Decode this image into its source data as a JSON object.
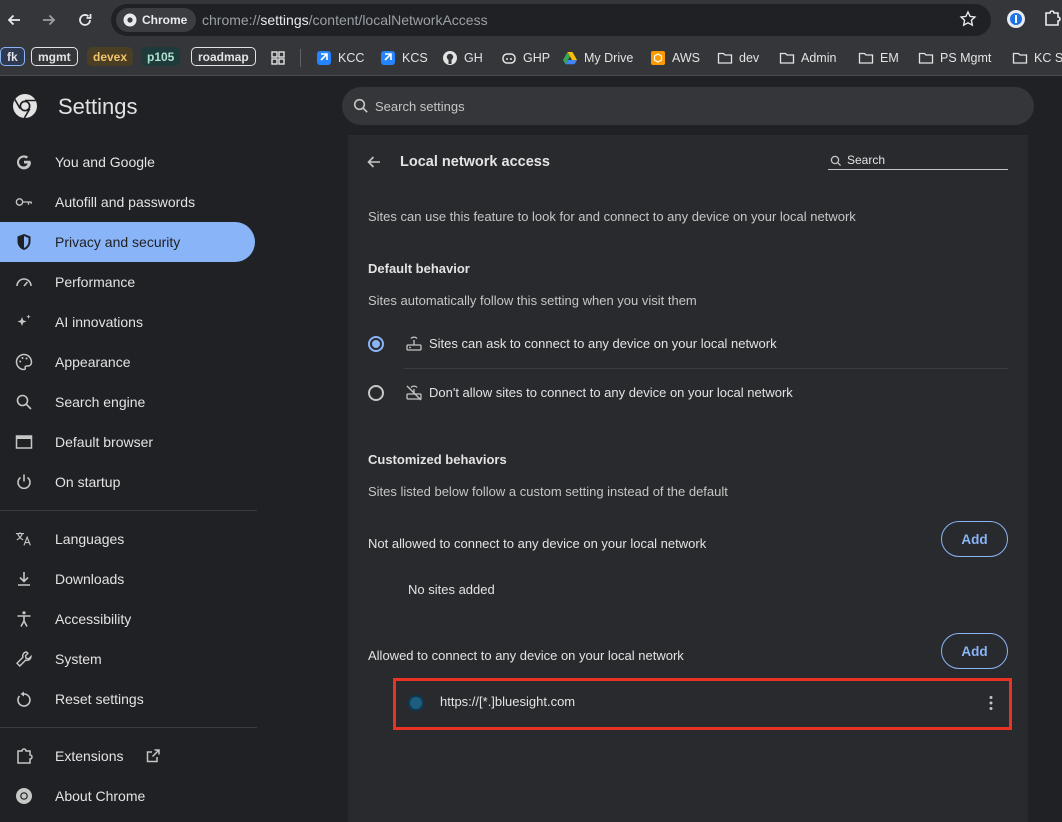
{
  "browser": {
    "chip_label": "Chrome",
    "url_prefix": "chrome://",
    "url_bold": "settings",
    "url_rest": "/content/localNetworkAccess",
    "bookmarks": {
      "tags": [
        {
          "label": "fk",
          "color": "#8ab4f8",
          "bg": "#3c4a66"
        },
        {
          "label": "mgmt",
          "color": "#e3e3e3",
          "bg": "#202124"
        },
        {
          "label": "devex",
          "color": "#f2c36b",
          "bg": "#4a3f24"
        },
        {
          "label": "p105",
          "color": "#81c995",
          "bg": "#1f3a2a"
        },
        {
          "label": "roadmap",
          "color": "#e3e3e3",
          "bg": "#202124"
        }
      ],
      "items": [
        "KCC",
        "KCS",
        "GH",
        "GHP",
        "My Drive",
        "AWS",
        "dev",
        "Admin",
        "EM",
        "PS Mgmt",
        "KC S"
      ]
    }
  },
  "settings": {
    "title": "Settings",
    "search_placeholder": "Search settings"
  },
  "sidebar": {
    "items": [
      {
        "label": "You and Google",
        "icon": "google-g-icon"
      },
      {
        "label": "Autofill and passwords",
        "icon": "key-icon"
      },
      {
        "label": "Privacy and security",
        "icon": "shield-icon",
        "active": true
      },
      {
        "label": "Performance",
        "icon": "gauge-icon"
      },
      {
        "label": "AI innovations",
        "icon": "sparkle-icon"
      },
      {
        "label": "Appearance",
        "icon": "palette-icon"
      },
      {
        "label": "Search engine",
        "icon": "search-icon"
      },
      {
        "label": "Default browser",
        "icon": "browser-window-icon"
      },
      {
        "label": "On startup",
        "icon": "power-icon"
      },
      {
        "label": "Languages",
        "icon": "translate-icon"
      },
      {
        "label": "Downloads",
        "icon": "download-icon"
      },
      {
        "label": "Accessibility",
        "icon": "accessibility-icon"
      },
      {
        "label": "System",
        "icon": "wrench-icon"
      },
      {
        "label": "Reset settings",
        "icon": "reset-icon"
      },
      {
        "label": "Extensions",
        "icon": "puzzle-icon"
      },
      {
        "label": "About Chrome",
        "icon": "chrome-logo-icon"
      }
    ]
  },
  "page": {
    "title": "Local network access",
    "search_placeholder": "Search",
    "description": "Sites can use this feature to look for and connect to any device on your local network",
    "default_behavior": {
      "heading": "Default behavior",
      "subtitle": "Sites automatically follow this setting when you visit them",
      "options": [
        {
          "label": "Sites can ask to connect to any device on your local network",
          "selected": true
        },
        {
          "label": "Don't allow sites to connect to any device on your local network",
          "selected": false
        }
      ]
    },
    "customized": {
      "heading": "Customized behaviors",
      "subtitle": "Sites listed below follow a custom setting instead of the default",
      "not_allowed": {
        "label": "Not allowed to connect to any device on your local network",
        "add_label": "Add",
        "empty_text": "No sites added"
      },
      "allowed": {
        "label": "Allowed to connect to any device on your local network",
        "add_label": "Add",
        "sites": [
          "https://[*.]bluesight.com"
        ]
      }
    }
  },
  "colors": {
    "accent": "#8ab4f8",
    "highlight": "#ea3323"
  }
}
